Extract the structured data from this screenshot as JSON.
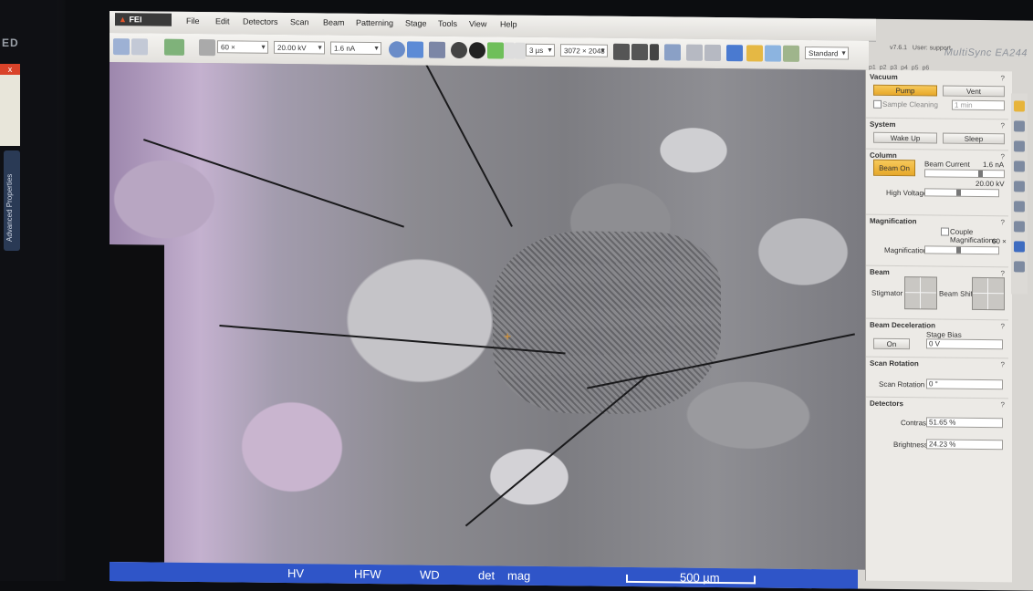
{
  "app": {
    "logo": "FEI",
    "version": "v7.6.1",
    "user": "User: support"
  },
  "other_monitor": {
    "brand": "ED",
    "panel_close": "x",
    "side_tab": "Advanced Properties"
  },
  "monitor_label": "MultiSync EA244",
  "menu": [
    "File",
    "Edit",
    "Detectors",
    "Scan",
    "Beam",
    "Patterning",
    "Stage",
    "Tools",
    "View",
    "Help"
  ],
  "toolbar": {
    "magnification": "60 ×",
    "high_voltage": "20.00 kV",
    "beam_current": "1.6 nA",
    "dwell": "3 µs",
    "resolution": "3072 × 2048",
    "preset": "Standard"
  },
  "presets": {
    "p": [
      "p1",
      "p2",
      "p3",
      "p4",
      "p5",
      "p6"
    ],
    "s": [
      "s1",
      "s2",
      "s3",
      "s4",
      "s5",
      "s6"
    ]
  },
  "status_bar": {
    "hv": "HV",
    "hfw": "HFW",
    "wd": "WD",
    "det": "det",
    "mag": "mag",
    "scale": "500 µm"
  },
  "panel": {
    "vacuum": {
      "title": "Vacuum",
      "pump": "Pump",
      "vent": "Vent",
      "sample_cleaning": "Sample Cleaning",
      "cleaning_time": "1 min"
    },
    "system": {
      "title": "System",
      "wake_up": "Wake Up",
      "sleep": "Sleep"
    },
    "column": {
      "title": "Column",
      "beam_on": "Beam On",
      "beam_current_label": "Beam Current",
      "beam_current_value": "1.6 nA",
      "high_voltage_label": "High Voltage",
      "high_voltage_value": "20.00 kV"
    },
    "magnification": {
      "title": "Magnification",
      "couple": "Couple Magnifications",
      "value": "60 ×",
      "label": "Magnification"
    },
    "beam": {
      "title": "Beam",
      "stigmator": "Stigmator",
      "beam_shift": "Beam Shift"
    },
    "beam_deceleration": {
      "title": "Beam Deceleration",
      "on": "On",
      "stage_bias_label": "Stage Bias",
      "stage_bias_value": "0 V"
    },
    "scan_rotation": {
      "title": "Scan Rotation",
      "label": "Scan Rotation",
      "value": "0 °"
    },
    "detectors": {
      "title": "Detectors",
      "contrast_label": "Contrast",
      "contrast_value": "51.65 %",
      "brightness_label": "Brightness",
      "brightness_value": "24.23 %"
    }
  }
}
